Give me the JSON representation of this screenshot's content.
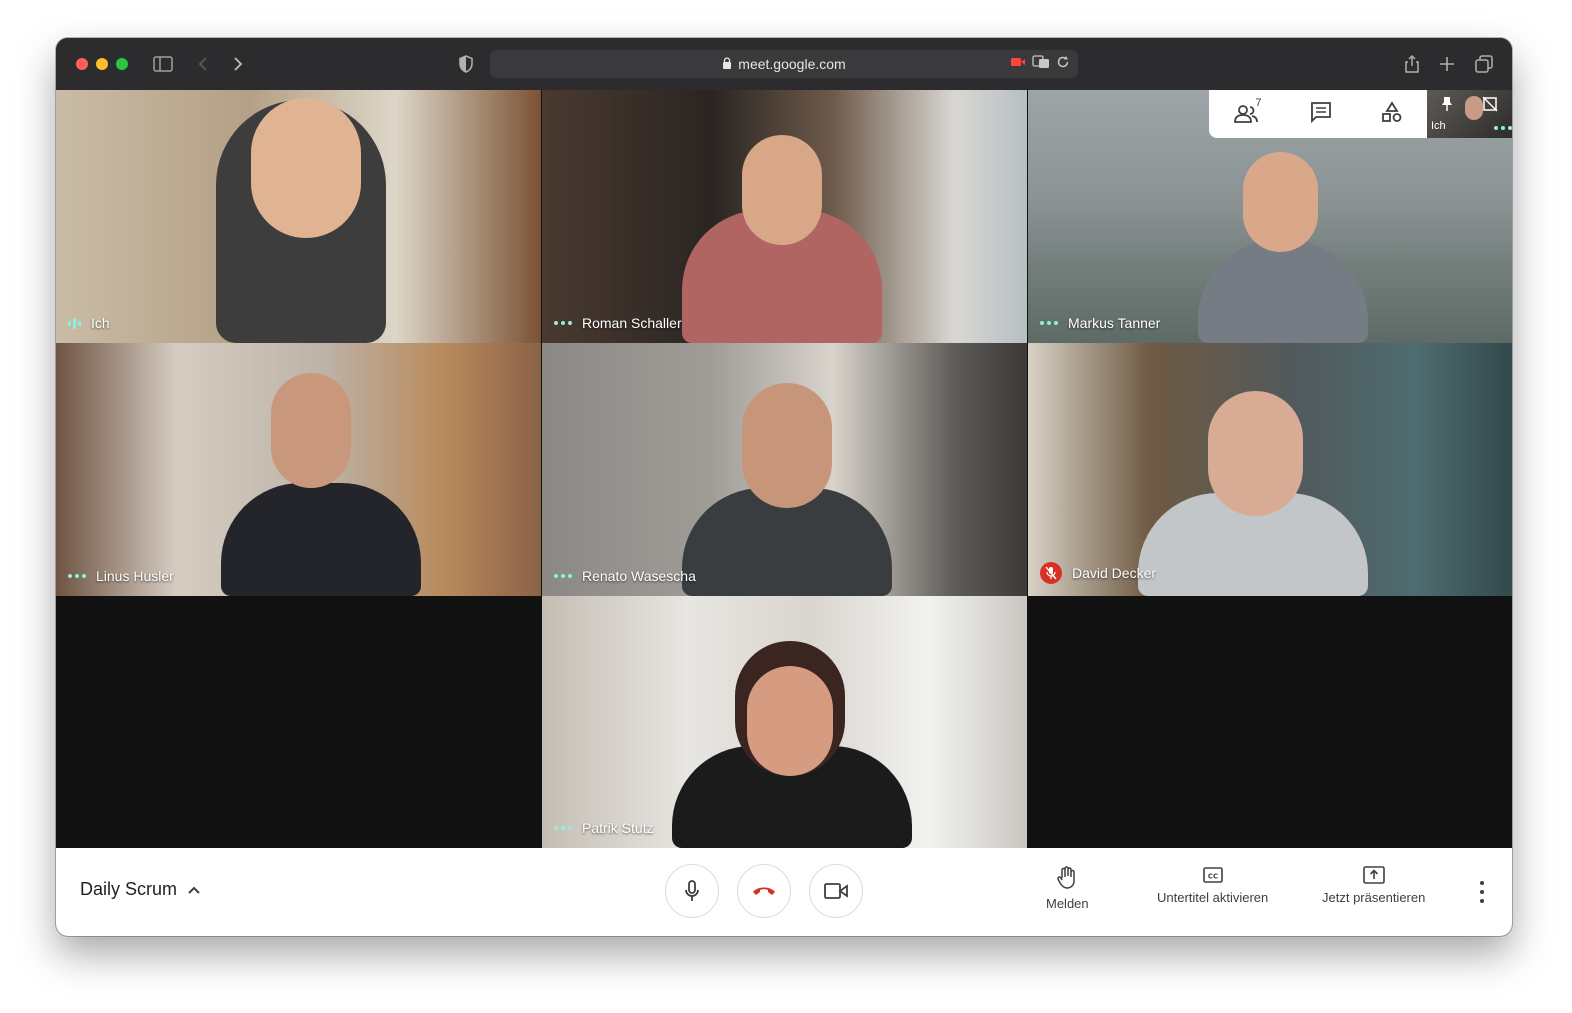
{
  "browser": {
    "url": "meet.google.com"
  },
  "participants": [
    {
      "name": "Ich",
      "status": "speaking",
      "bg": "#b9a58a"
    },
    {
      "name": "Roman Schaller",
      "status": "dots",
      "bg": "#6b5646"
    },
    {
      "name": "Markus Tanner",
      "status": "dots",
      "bg": "#8d9596"
    },
    {
      "name": "Linus Husler",
      "status": "dots",
      "bg": "#b4a99b"
    },
    {
      "name": "Renato Wasescha",
      "status": "dots",
      "bg": "#878683"
    },
    {
      "name": "David Decker",
      "status": "muted",
      "bg": "#6f7163"
    },
    {
      "name": "Patrik Stutz",
      "status": "dots",
      "bg": "#c8c2b8"
    }
  ],
  "panel": {
    "people_count": "7",
    "self_label": "Ich"
  },
  "bottombar": {
    "meeting_title": "Daily Scrum",
    "actions": {
      "raise_hand": "Melden",
      "captions": "Untertitel aktivieren",
      "present": "Jetzt präsentieren"
    }
  },
  "colors": {
    "hangup": "#d93025",
    "active_indicator": "#8ff0d9"
  }
}
